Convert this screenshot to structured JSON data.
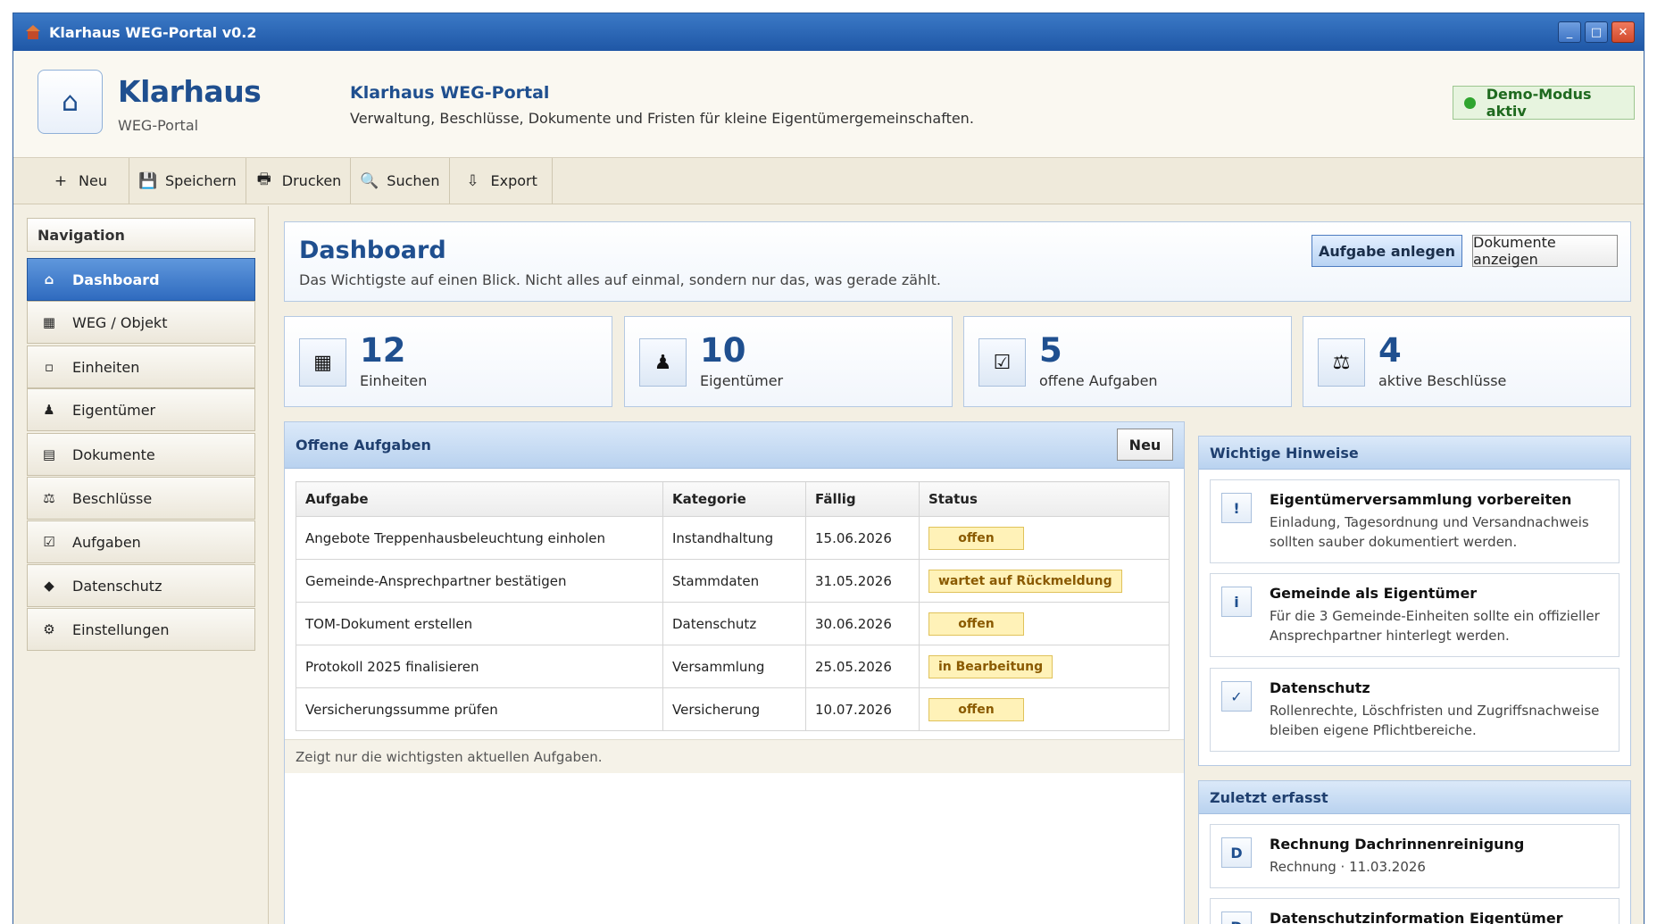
{
  "window": {
    "title": "Klarhaus WEG-Portal v0.2",
    "minimize": "_",
    "maximize": "□",
    "close": "✕"
  },
  "header": {
    "brand": "Klarhaus",
    "brand_sub": "WEG-Portal",
    "title": "Klarhaus WEG-Portal",
    "description": "Verwaltung, Beschlüsse, Dokumente und Fristen für kleine Eigentümergemeinschaften.",
    "demo_badge": "Demo-Modus aktiv"
  },
  "toolbar": {
    "neu": "Neu",
    "speichern": "Speichern",
    "drucken": "Drucken",
    "suchen": "Suchen",
    "export": "Export"
  },
  "sidebar": {
    "heading": "Navigation",
    "items": [
      {
        "label": "Dashboard",
        "icon": "home-icon"
      },
      {
        "label": "WEG / Objekt",
        "icon": "building-grid-icon"
      },
      {
        "label": "Einheiten",
        "icon": "unit-square-icon"
      },
      {
        "label": "Eigentümer",
        "icon": "person-icon"
      },
      {
        "label": "Dokumente",
        "icon": "document-icon"
      },
      {
        "label": "Beschlüsse",
        "icon": "scales-icon"
      },
      {
        "label": "Aufgaben",
        "icon": "checkbox-icon"
      },
      {
        "label": "Datenschutz",
        "icon": "diamond-icon"
      },
      {
        "label": "Einstellungen",
        "icon": "gear-icon"
      }
    ]
  },
  "dashboard": {
    "title": "Dashboard",
    "subtitle": "Das Wichtigste auf einen Blick. Nicht alles auf einmal, sondern nur das, was gerade zählt.",
    "primary_button": "Aufgabe anlegen",
    "secondary_button": "Dokumente anzeigen"
  },
  "stats": [
    {
      "value": "12",
      "label": "Einheiten"
    },
    {
      "value": "10",
      "label": "Eigentümer"
    },
    {
      "value": "5",
      "label": "offene Aufgaben"
    },
    {
      "value": "4",
      "label": "aktive Beschlüsse"
    }
  ],
  "tasks": {
    "title": "Offene Aufgaben",
    "new_button": "Neu",
    "columns": [
      "Aufgabe",
      "Kategorie",
      "Fällig",
      "Status"
    ],
    "rows": [
      {
        "task": "Angebote Treppenhausbeleuchtung einholen",
        "category": "Instandhaltung",
        "due": "15.06.2026",
        "status": "offen"
      },
      {
        "task": "Gemeinde-Ansprechpartner bestätigen",
        "category": "Stammdaten",
        "due": "31.05.2026",
        "status": "wartet auf Rückmeldung"
      },
      {
        "task": "TOM-Dokument erstellen",
        "category": "Datenschutz",
        "due": "30.06.2026",
        "status": "offen"
      },
      {
        "task": "Protokoll 2025 finalisieren",
        "category": "Versammlung",
        "due": "25.05.2026",
        "status": "in Bearbeitung"
      },
      {
        "task": "Versicherungssumme prüfen",
        "category": "Versicherung",
        "due": "10.07.2026",
        "status": "offen"
      }
    ],
    "footer": "Zeigt nur die wichtigsten aktuellen Aufgaben."
  },
  "hints": {
    "title": "Wichtige Hinweise",
    "items": [
      {
        "icon": "!",
        "title": "Eigentümerversammlung vorbereiten",
        "text": "Einladung, Tagesordnung und Versandnachweis sollten sauber dokumentiert werden."
      },
      {
        "icon": "i",
        "title": "Gemeinde als Eigentümer",
        "text": "Für die 3 Gemeinde-Einheiten sollte ein offizieller Ansprechpartner hinterlegt werden."
      },
      {
        "icon": "✓",
        "title": "Datenschutz",
        "text": "Rollenrechte, Löschfristen und Zugriffsnachweise bleiben eigene Pflichtbereiche."
      }
    ]
  },
  "recent": {
    "title": "Zuletzt erfasst",
    "items": [
      {
        "icon": "D",
        "title": "Rechnung Dachrinnenreinigung",
        "text": "Rechnung · 11.03.2026"
      },
      {
        "icon": "D",
        "title": "Datenschutzinformation Eigentümer",
        "text": ""
      }
    ]
  },
  "colors": {
    "accent": "#1f4f8f",
    "titlebar": "#2f6bbf",
    "status_bg": "#fff2b8",
    "demo_green": "#2fa52f"
  }
}
